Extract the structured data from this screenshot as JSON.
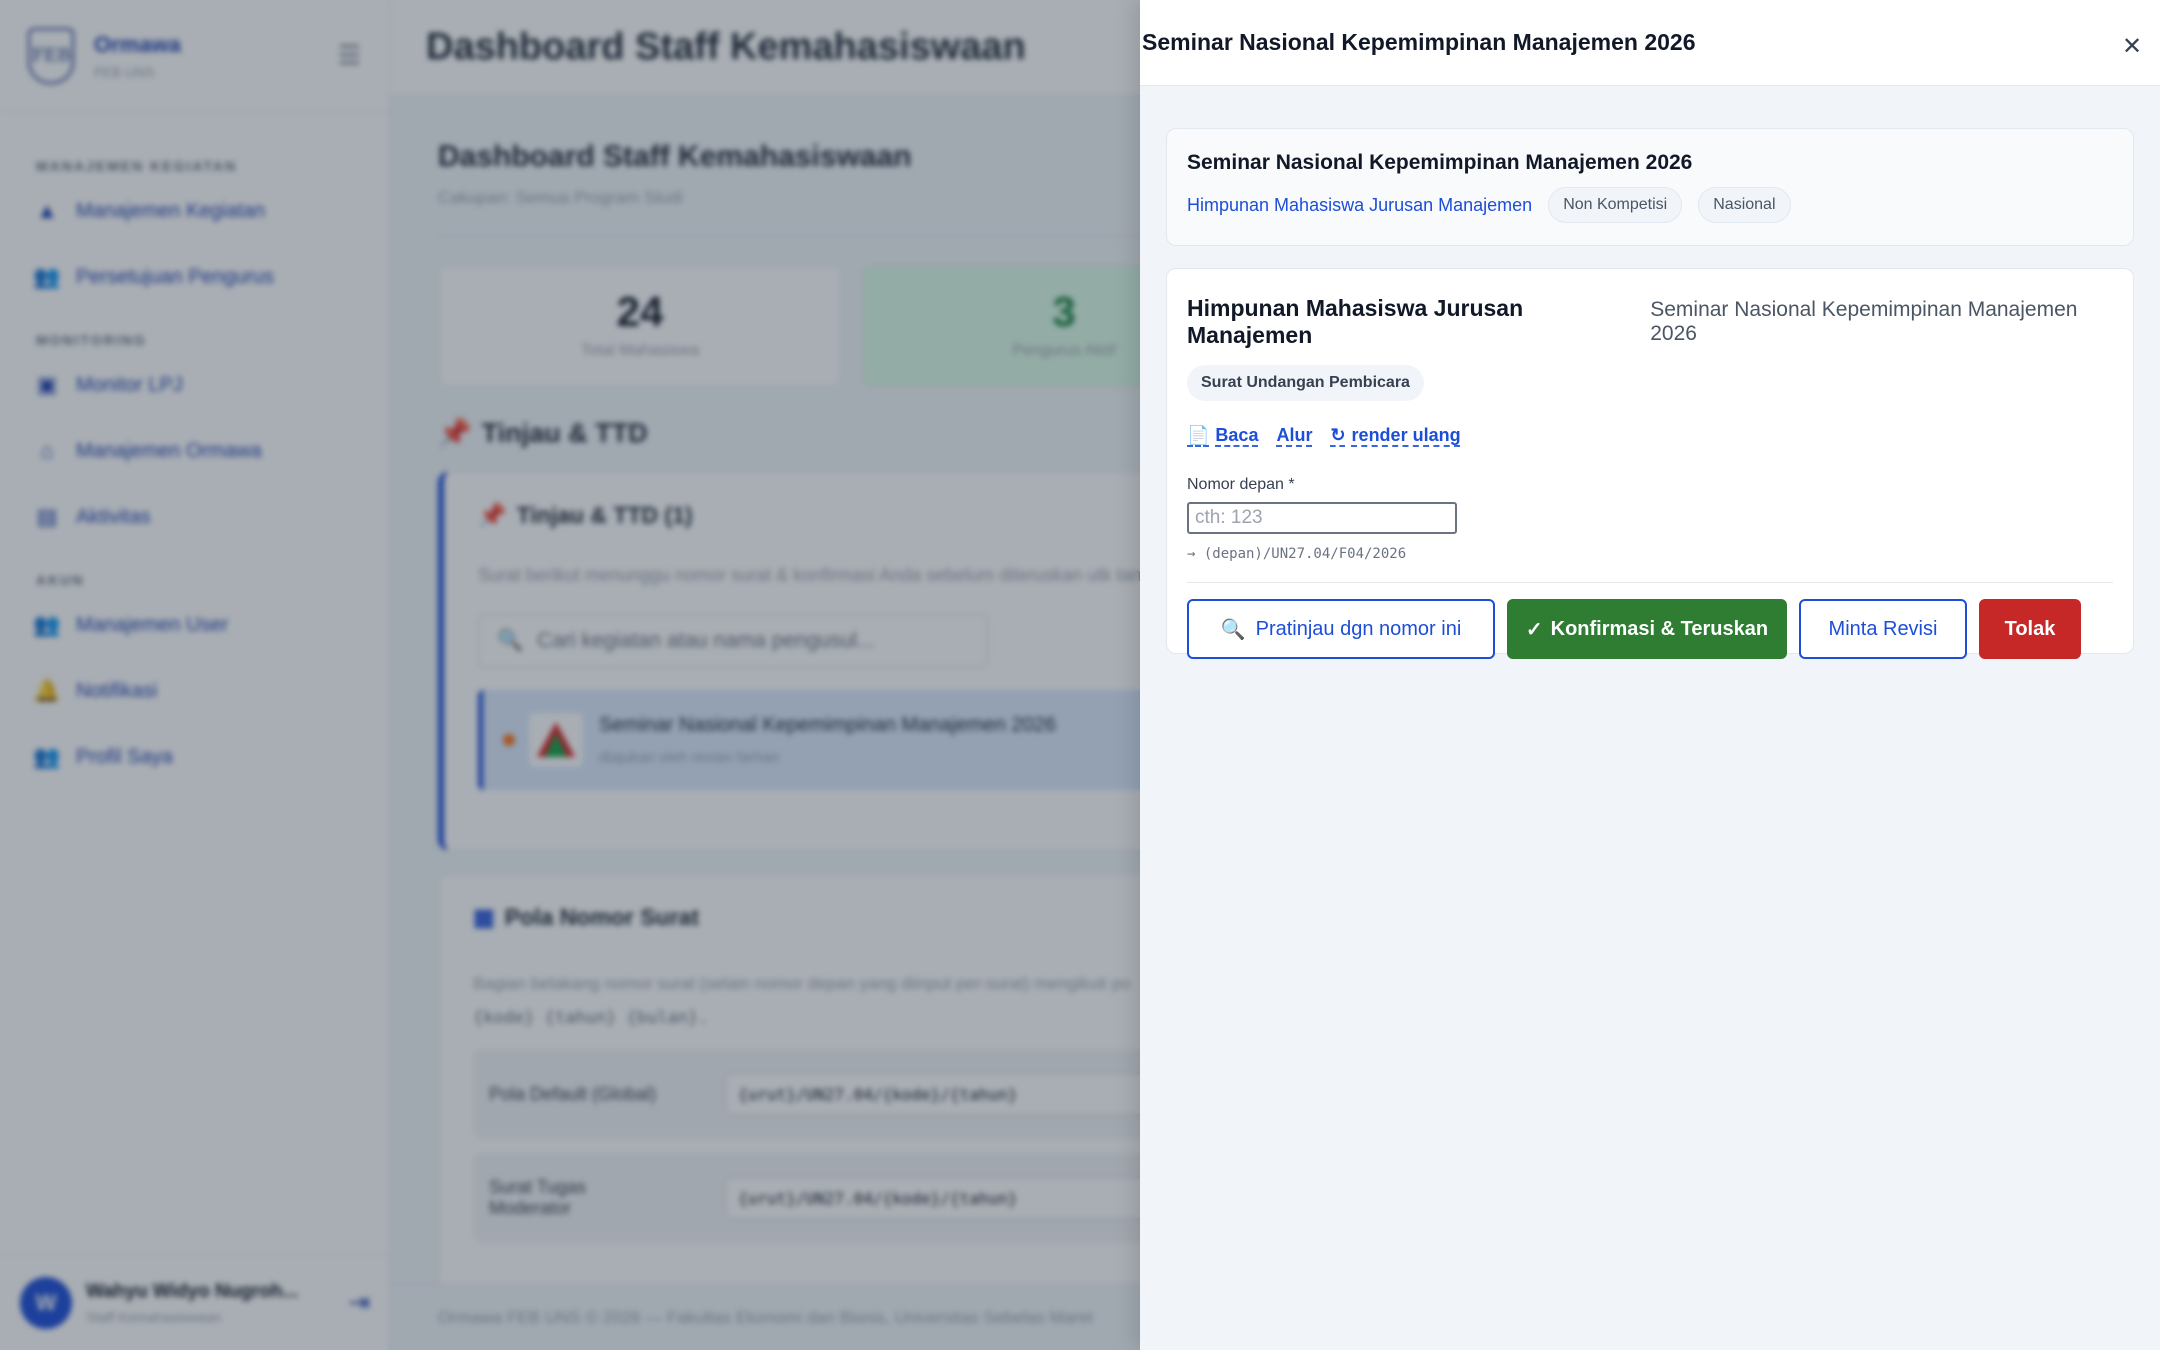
{
  "sidebar": {
    "brand_name": "Ormawa",
    "brand_sub": "FEB UNS",
    "sections": [
      {
        "title": "MANAJEMEN KEGIATAN",
        "items": [
          {
            "label": "Manajemen Kegiatan",
            "icon": "warning-icon"
          },
          {
            "label": "Persetujuan Pengurus",
            "icon": "people-icon"
          }
        ]
      },
      {
        "title": "MONITORING",
        "items": [
          {
            "label": "Monitor LPJ",
            "icon": "calendar-icon"
          },
          {
            "label": "Manajemen Ormawa",
            "icon": "home-icon"
          },
          {
            "label": "Aktivitas",
            "icon": "clipboard-icon"
          }
        ]
      },
      {
        "title": "AKUN",
        "items": [
          {
            "label": "Manajemen User",
            "icon": "people-icon"
          },
          {
            "label": "Notifikasi",
            "icon": "bell-icon"
          },
          {
            "label": "Profil Saya",
            "icon": "people-icon"
          }
        ]
      }
    ],
    "user": {
      "initial": "W",
      "name": "Wahyu Widyo Nugroh...",
      "role": "Staff Kemahasiswaan"
    }
  },
  "topbar": {
    "title": "Dashboard Staff Kemahasiswaan"
  },
  "main": {
    "title": "Dashboard Staff Kemahasiswaan",
    "subtitle": "Cakupan: Semua Program Studi",
    "stats": [
      {
        "value": "24",
        "label": "Total Mahasiswa"
      },
      {
        "value": "3",
        "label": "Pengurus Aktif"
      }
    ],
    "review_section_title": "Tinjau & TTD",
    "review_card": {
      "title": "Tinjau & TTD (1)",
      "desc": "Surat berikut menunggu nomor surat & konfirmasi Anda sebelum diteruskan utk tanda",
      "search_placeholder": "Cari kegiatan atau nama pengusul...",
      "item": {
        "title": "Seminar Nasional Kepemimpinan Manajemen 2026",
        "sub": "diajukan oleh revian farhan"
      }
    },
    "pola_card": {
      "title": "Pola Nomor Surat",
      "desc": "Bagian belakang nomor surat (selain nomor depan yang diinput per-surat) mengikuti po",
      "desc_codes": "{kode} {tahun} {bulan}.",
      "rows": [
        {
          "label": "Pola Default (Global)",
          "value": "{urut}/UN27.04/{kode}/{tahun}"
        },
        {
          "label": "Surat Tugas Moderator",
          "value": "{urut}/UN27.04/{kode}/{tahun}"
        }
      ]
    },
    "footer": "Ormawa FEB UNS © 2026 — Fakultas Ekonomi dan Bisnis, Universitas Sebelas Maret"
  },
  "drawer": {
    "title": "Seminar Nasional Kepemimpinan Manajemen 2026",
    "info": {
      "title": "Seminar Nasional Kepemimpinan Manajemen 2026",
      "org": "Himpunan Mahasiswa Jurusan Manajemen",
      "tags": [
        "Non Kompetisi",
        "Nasional"
      ]
    },
    "doc": {
      "org": "Himpunan Mahasiswa Jurusan Manajemen",
      "event": "Seminar Nasional Kepemimpinan Manajemen 2026",
      "tag": "Surat Undangan Pembicara",
      "links": {
        "read": "Baca",
        "flow": "Alur",
        "rerender": "render ulang"
      },
      "field_label": "Nomor depan *",
      "field_placeholder": "cth: 123",
      "field_hint": "→ (depan)/UN27.04/F04/2026"
    },
    "actions": {
      "preview": "Pratinjau dgn nomor ini",
      "confirm": "Konfirmasi & Teruskan",
      "revise": "Minta Revisi",
      "reject": "Tolak"
    }
  },
  "colors": {
    "primary": "#1d4ed8",
    "success": "#2e7d32",
    "danger": "#c62828"
  }
}
